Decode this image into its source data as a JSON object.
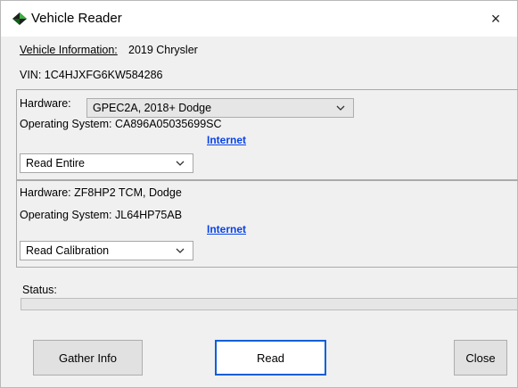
{
  "window": {
    "title": "Vehicle Reader",
    "close_glyph": "×",
    "icon": "diamond-app-icon"
  },
  "vehicle": {
    "info_label": "Vehicle Information:",
    "info_value": "2019 Chrysler",
    "vin": "VIN: 1C4HJXFG6KW584286"
  },
  "module1": {
    "hardware_label": "Hardware:",
    "hardware_selected": "GPEC2A, 2018+ Dodge",
    "os": "Operating System: CA896A05035699SC",
    "link": "Internet",
    "mode_selected": "Read Entire"
  },
  "module2": {
    "hardware": "Hardware: ZF8HP2 TCM, Dodge",
    "os": "Operating System: JL64HP75AB",
    "link": "Internet",
    "mode_selected": "Read Calibration"
  },
  "status": {
    "label": "Status:",
    "progress": 0
  },
  "buttons": {
    "gather": "Gather Info",
    "read": "Read",
    "close": "Close"
  },
  "colors": {
    "link": "#0a43e6",
    "default_button_border": "#0a5fd8",
    "window_bg": "#f0f0f0"
  }
}
